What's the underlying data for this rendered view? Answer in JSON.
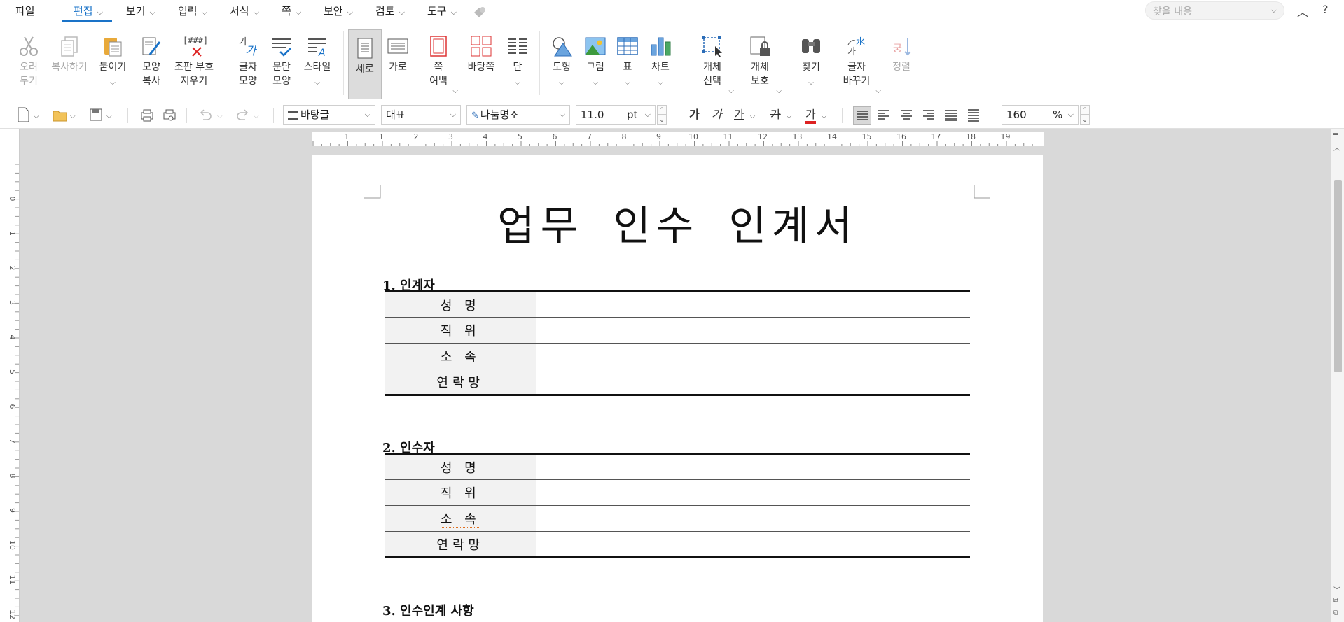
{
  "menubar": {
    "file": "파일",
    "items": [
      {
        "label": "편집",
        "active": true
      },
      {
        "label": "보기"
      },
      {
        "label": "입력"
      },
      {
        "label": "서식"
      },
      {
        "label": "쪽"
      },
      {
        "label": "보안"
      },
      {
        "label": "검토"
      },
      {
        "label": "도구"
      }
    ],
    "search_placeholder": "찾을 내용"
  },
  "ribbon": {
    "cut": "오려\n두기",
    "copy": "복사하기",
    "paste": "붙이기",
    "format_copy": "모양\n복사",
    "clear_marks": "조판 부호\n지우기",
    "clear_marks_icon_text": "[###]",
    "char_shape": "글자\n모양",
    "para_shape": "문단\n모양",
    "style": "스타일",
    "portrait": "세로",
    "landscape": "가로",
    "page_margin": "쪽\n여백",
    "master_page": "바탕쪽",
    "columns": "단",
    "shape": "도형",
    "picture": "그림",
    "table": "표",
    "chart": "차트",
    "object_select": "개체\n선택",
    "object_protect": "개체\n보호",
    "find": "찾기",
    "char_replace": "글자\n바꾸기",
    "sort": "정렬",
    "char_icon_text": "가",
    "char_replace_icon_text": "水",
    "sort_icon_text": "궁"
  },
  "toolbar": {
    "style_name": "바탕글",
    "font_lang": "대표",
    "font_name": "나눔명조",
    "font_size": "11.0",
    "font_unit": "pt",
    "zoom": "160",
    "zoom_unit": "%",
    "bold": "가",
    "italic": "가",
    "underline": "가",
    "strike": "가",
    "color": "가"
  },
  "ruler": {
    "h_labels": [
      "1",
      "1",
      "2",
      "3",
      "4",
      "5",
      "6",
      "7",
      "8",
      "9",
      "10",
      "11",
      "12",
      "13",
      "14",
      "15",
      "16",
      "17",
      "18",
      "19"
    ],
    "v_labels": [
      "0",
      "1",
      "2",
      "3",
      "4",
      "5",
      "6",
      "7",
      "8",
      "9",
      "10",
      "11",
      "12"
    ]
  },
  "document": {
    "title": "업무 인수 인계서",
    "sections": [
      {
        "heading": "1. 인계자",
        "rows": [
          "성 명",
          "직 위",
          "소 속",
          "연락망"
        ]
      },
      {
        "heading": "2. 인수자",
        "rows": [
          "성 명",
          "직 위",
          "소 속",
          "연락망"
        ]
      },
      {
        "heading": "3. 인수인계 사항"
      }
    ]
  },
  "colors": {
    "accent": "#1a73c8",
    "workspace": "#d9d9d9"
  }
}
